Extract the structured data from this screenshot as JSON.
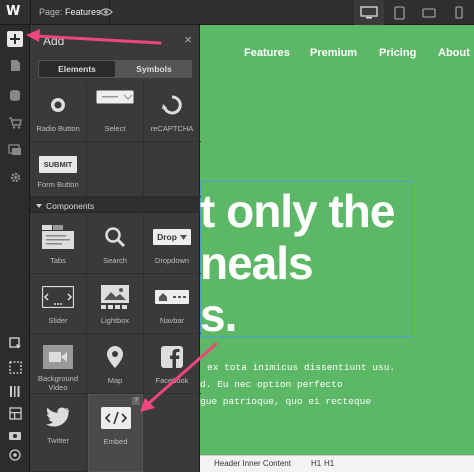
{
  "topbar": {
    "logo": "W",
    "page_prefix": "Page:",
    "page_name": "Features",
    "devices": [
      "desktop-icon",
      "tablet-icon",
      "mobile-landscape-icon",
      "mobile-portrait-icon"
    ]
  },
  "rail": {
    "top_icons": [
      "add-icon",
      "pages-icon",
      "database-icon",
      "ecommerce-icon",
      "assets-icon",
      "settings-icon"
    ],
    "bottom_icons": [
      "select-icon",
      "dashed-box-icon",
      "ruler-icon",
      "grid-icon",
      "camera-icon",
      "help-icon"
    ]
  },
  "panel": {
    "title": "Add",
    "close": "×",
    "tabs": [
      "Elements",
      "Symbols"
    ],
    "forms": [
      {
        "label": "Radio Button",
        "icon": "radio-icon"
      },
      {
        "label": "Select",
        "icon": "select-field-icon"
      },
      {
        "label": "reCAPTCHA",
        "icon": "recaptcha-icon"
      },
      {
        "label": "Form Button",
        "icon": "submit-icon",
        "text": "SUBMIT"
      }
    ],
    "section_title": "Components",
    "components": [
      {
        "label": "Tabs",
        "icon": "tabs-icon"
      },
      {
        "label": "Search",
        "icon": "search-icon"
      },
      {
        "label": "Dropdown",
        "icon": "dropdown-icon",
        "text": "Drop"
      },
      {
        "label": "Slider",
        "icon": "slider-icon"
      },
      {
        "label": "Lightbox",
        "icon": "lightbox-icon"
      },
      {
        "label": "Navbar",
        "icon": "navbar-icon"
      },
      {
        "label": "Background Video",
        "icon": "video-icon"
      },
      {
        "label": "Map",
        "icon": "map-pin-icon"
      },
      {
        "label": "Facebook",
        "icon": "facebook-icon"
      },
      {
        "label": "Twitter",
        "icon": "twitter-icon"
      },
      {
        "label": "Embed",
        "icon": "embed-icon",
        "help": "?"
      }
    ]
  },
  "canvas": {
    "nav": [
      "Features",
      "Premium",
      "Pricing",
      "About"
    ],
    "headline": [
      "t only the",
      "neals",
      "s."
    ],
    "paragraph": [
      "ex tota inimicus dissentiunt usu.",
      "d. Eu nec option perfecto",
      "gue patrioque, quo ei recteque"
    ]
  },
  "breadcrumb": {
    "items": [
      "Header Inner Content",
      "H1",
      "H1"
    ]
  },
  "colors": {
    "canvas_green": "#5cb866",
    "annotation_arrow": "#f0467e",
    "selection": "#4a9fd8"
  }
}
